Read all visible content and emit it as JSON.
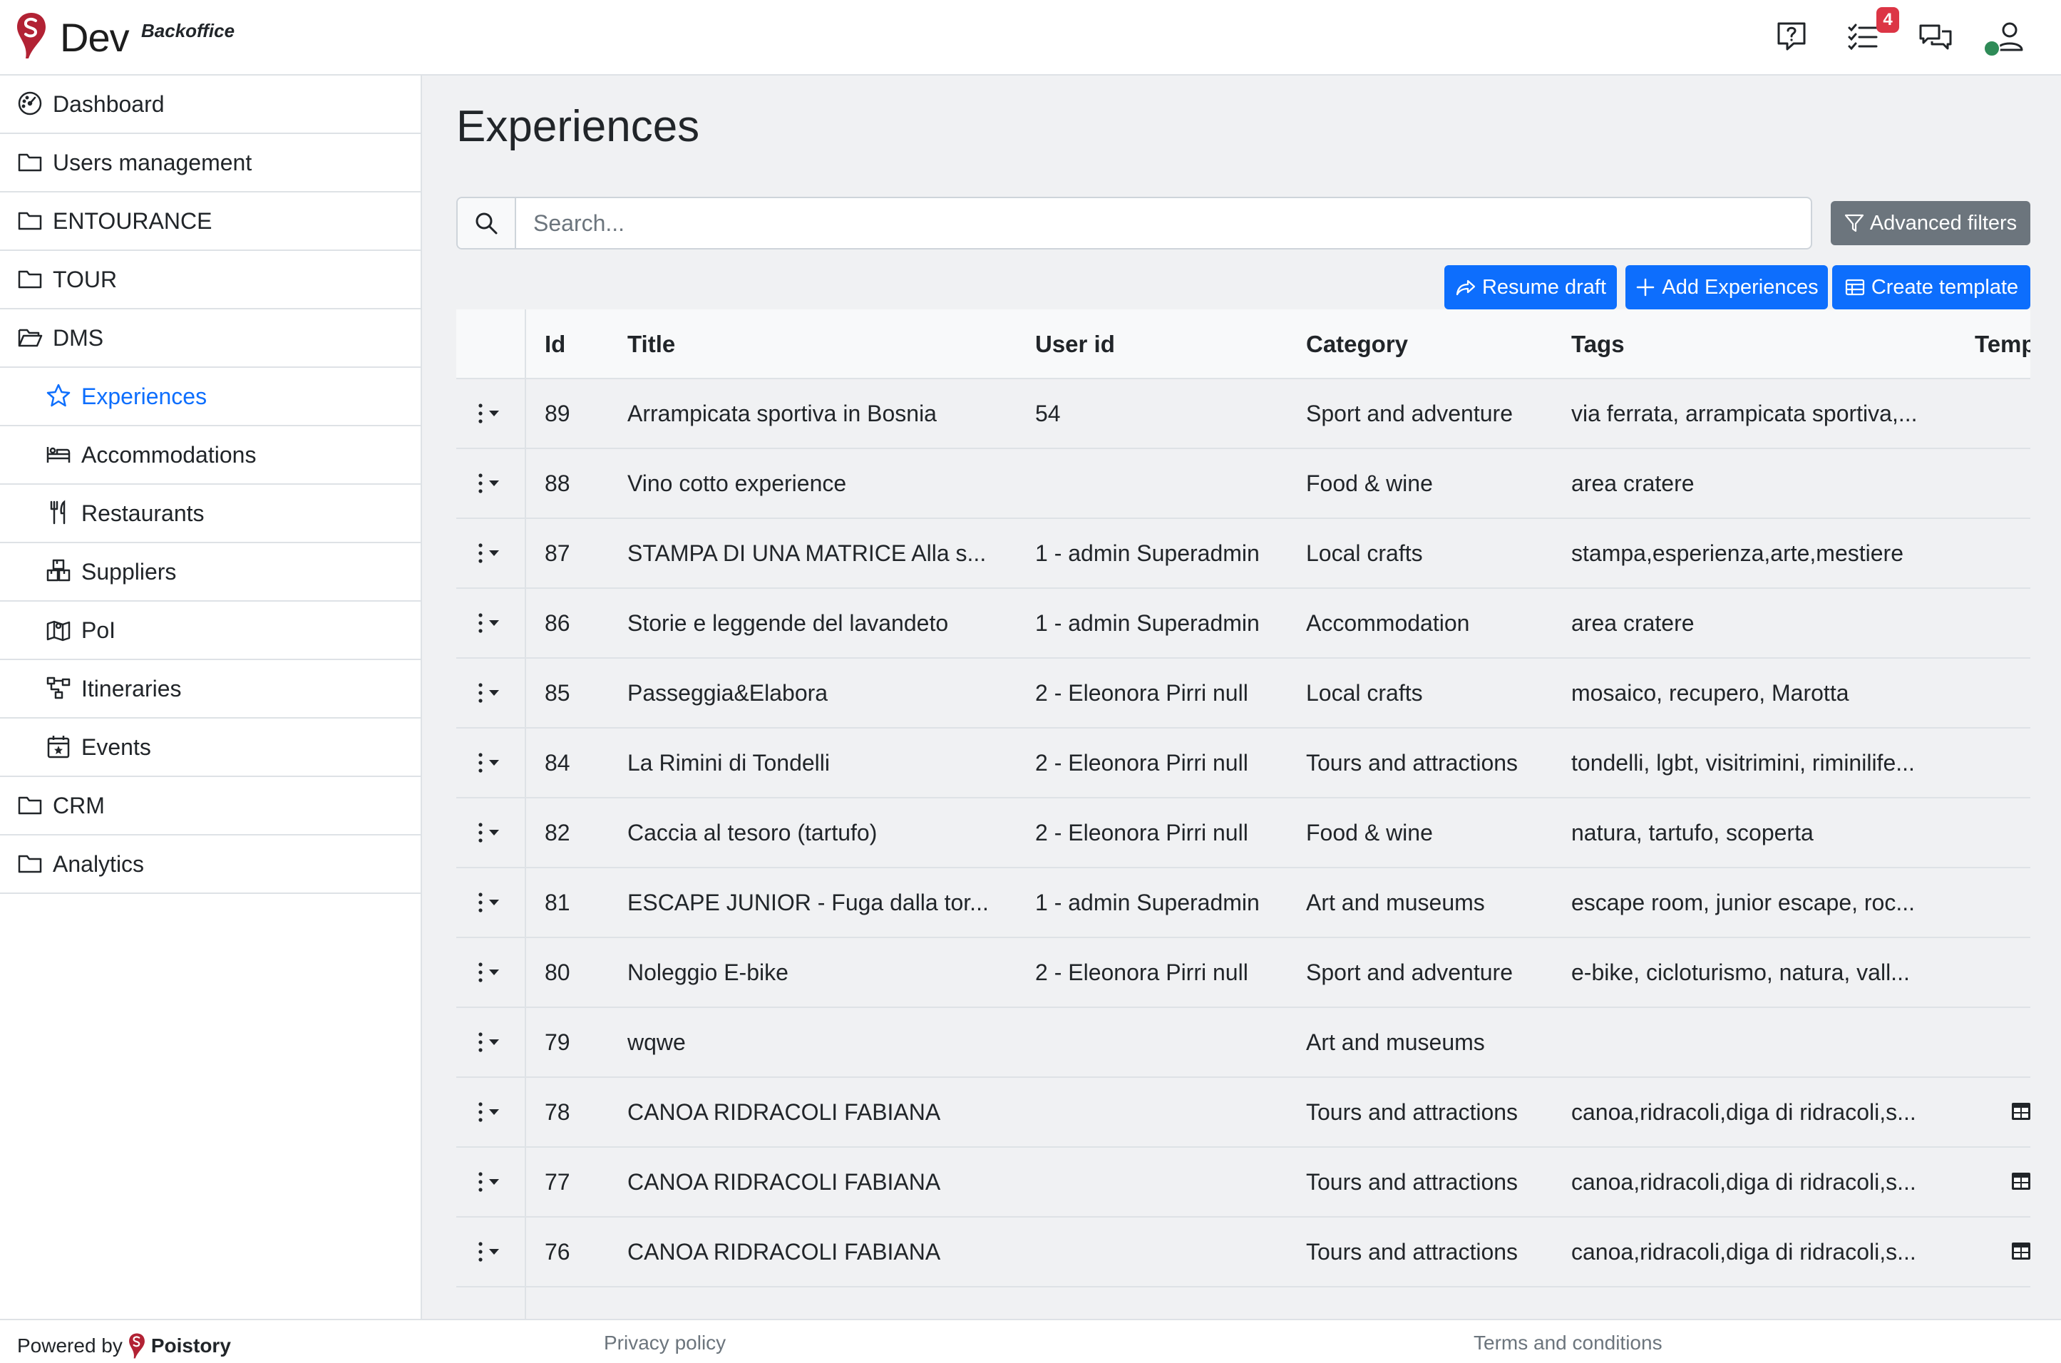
{
  "app": {
    "brand": "Dev",
    "brand_sub": "Backoffice",
    "tasks_badge": "4"
  },
  "topbar_icons": [
    "help-question-icon",
    "tasks-list-icon",
    "chat-icon",
    "user-icon"
  ],
  "sidebar": {
    "items": [
      {
        "label": "Dashboard",
        "icon": "speedometer-icon",
        "sub": false,
        "active": false
      },
      {
        "label": "Users management",
        "icon": "folder-icon",
        "sub": false,
        "active": false
      },
      {
        "label": "ENTOURANCE",
        "icon": "folder-icon",
        "sub": false,
        "active": false
      },
      {
        "label": "TOUR",
        "icon": "folder-icon",
        "sub": false,
        "active": false
      },
      {
        "label": "DMS",
        "icon": "folder-open-icon",
        "sub": false,
        "active": false
      },
      {
        "label": "Experiences",
        "icon": "star-icon",
        "sub": true,
        "active": true
      },
      {
        "label": "Accommodations",
        "icon": "bed-icon",
        "sub": true,
        "active": false
      },
      {
        "label": "Restaurants",
        "icon": "fork-knife-icon",
        "sub": true,
        "active": false
      },
      {
        "label": "Suppliers",
        "icon": "boxes-icon",
        "sub": true,
        "active": false
      },
      {
        "label": "PoI",
        "icon": "map-icon",
        "sub": true,
        "active": false
      },
      {
        "label": "Itineraries",
        "icon": "diagram-icon",
        "sub": true,
        "active": false
      },
      {
        "label": "Events",
        "icon": "calendar-event-icon",
        "sub": true,
        "active": false
      },
      {
        "label": "CRM",
        "icon": "folder-icon",
        "sub": false,
        "active": false
      },
      {
        "label": "Analytics",
        "icon": "folder-icon",
        "sub": false,
        "active": false
      }
    ]
  },
  "main": {
    "title": "Experiences",
    "search_placeholder": "Search...",
    "search_value": "",
    "advanced_filters": "Advanced filters",
    "resume_draft": "Resume draft",
    "add_experiences": "Add Experiences",
    "create_template": "Create template"
  },
  "table": {
    "columns": [
      "Id",
      "Title",
      "User id",
      "Category",
      "Tags",
      "Temp"
    ],
    "rows": [
      {
        "id": "89",
        "title": "Arrampicata sportiva in Bosnia",
        "user": "54",
        "category": "Sport and adventure",
        "tags": "via ferrata, arrampicata sportiva,...",
        "template": false
      },
      {
        "id": "88",
        "title": "Vino cotto experience",
        "user": "",
        "category": "Food & wine",
        "tags": "area cratere",
        "template": false
      },
      {
        "id": "87",
        "title": "STAMPA DI UNA MATRICE Alla s...",
        "user": "1 - admin Superadmin",
        "category": "Local crafts",
        "tags": "stampa,esperienza,arte,mestiere",
        "template": false
      },
      {
        "id": "86",
        "title": "Storie e leggende del lavandeto",
        "user": "1 - admin Superadmin",
        "category": "Accommodation",
        "tags": "area cratere",
        "template": false
      },
      {
        "id": "85",
        "title": "Passeggia&Elabora",
        "user": "2 - Eleonora Pirri null",
        "category": "Local crafts",
        "tags": "mosaico, recupero, Marotta",
        "template": false
      },
      {
        "id": "84",
        "title": "La Rimini di Tondelli",
        "user": "2 - Eleonora Pirri null",
        "category": "Tours and attractions",
        "tags": "tondelli, lgbt, visitrimini, riminilife...",
        "template": false
      },
      {
        "id": "82",
        "title": "Caccia al tesoro (tartufo)",
        "user": "2 - Eleonora Pirri null",
        "category": "Food & wine",
        "tags": "natura, tartufo, scoperta",
        "template": false
      },
      {
        "id": "81",
        "title": "ESCAPE JUNIOR - Fuga dalla tor...",
        "user": "1 - admin Superadmin",
        "category": "Art and museums",
        "tags": "escape room, junior escape, roc...",
        "template": false
      },
      {
        "id": "80",
        "title": "Noleggio E-bike",
        "user": "2 - Eleonora Pirri null",
        "category": "Sport and adventure",
        "tags": "e-bike, cicloturismo, natura, vall...",
        "template": false
      },
      {
        "id": "79",
        "title": "wqwe",
        "user": "",
        "category": "Art and museums",
        "tags": "",
        "template": false
      },
      {
        "id": "78",
        "title": "CANOA RIDRACOLI FABIANA",
        "user": "",
        "category": "Tours and attractions",
        "tags": "canoa,ridracoli,diga di ridracoli,s...",
        "template": true
      },
      {
        "id": "77",
        "title": "CANOA RIDRACOLI FABIANA",
        "user": "",
        "category": "Tours and attractions",
        "tags": "canoa,ridracoli,diga di ridracoli,s...",
        "template": true
      },
      {
        "id": "76",
        "title": "CANOA RIDRACOLI FABIANA",
        "user": "",
        "category": "Tours and attractions",
        "tags": "canoa,ridracoli,diga di ridracoli,s...",
        "template": true
      }
    ]
  },
  "footer": {
    "powered_by": "Powered by",
    "powered_brand": "Poistory",
    "privacy": "Privacy policy",
    "terms": "Terms and conditions"
  },
  "colors": {
    "primary": "#0d6efd",
    "secondary": "#6c757d",
    "danger": "#dc3545",
    "brand_red": "#b22234",
    "online": "#2e8b57"
  }
}
